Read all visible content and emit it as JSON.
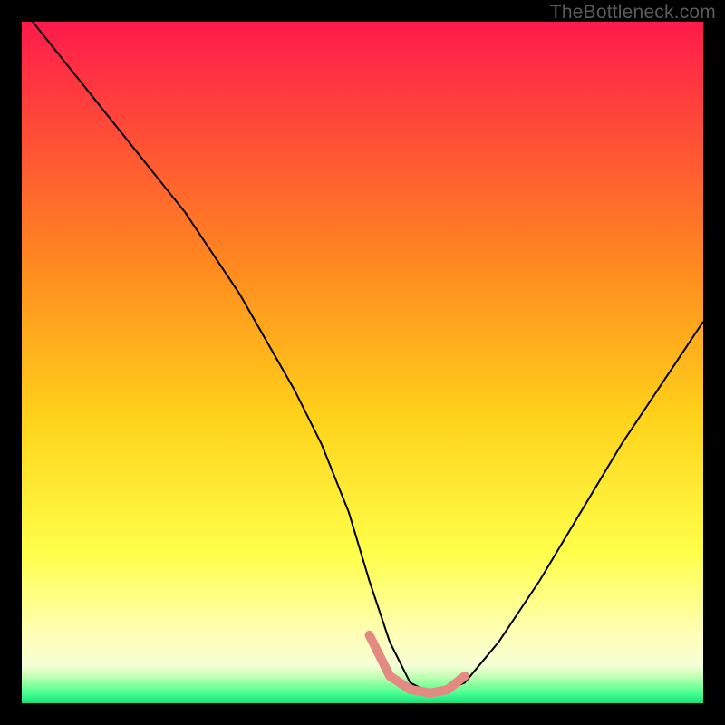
{
  "watermark": "TheBottleneck.com",
  "chart_data": {
    "type": "line",
    "title": "",
    "xlabel": "",
    "ylabel": "",
    "xlim": [
      0,
      100
    ],
    "ylim": [
      0,
      100
    ],
    "grid": false,
    "legend": false,
    "annotations": [],
    "background_gradient_stops": [
      {
        "offset": 0.0,
        "color": "#ff1a4b"
      },
      {
        "offset": 0.36,
        "color": "#ff8a1f"
      },
      {
        "offset": 0.58,
        "color": "#ffd21a"
      },
      {
        "offset": 0.78,
        "color": "#ffff4a"
      },
      {
        "offset": 0.9,
        "color": "#ffffb8"
      },
      {
        "offset": 0.945,
        "color": "#f5ffd6"
      },
      {
        "offset": 0.958,
        "color": "#cdffba"
      },
      {
        "offset": 0.972,
        "color": "#8cff9e"
      },
      {
        "offset": 0.985,
        "color": "#49ff93"
      },
      {
        "offset": 1.0,
        "color": "#18e07a"
      }
    ],
    "series": [
      {
        "name": "bottleneck-curve",
        "color": "#000000",
        "stroke_width": 2,
        "x": [
          0,
          8,
          16,
          24,
          32,
          40,
          44,
          48,
          51,
          54,
          57,
          60,
          62.5,
          65,
          70,
          76,
          82,
          88,
          94,
          100
        ],
        "values": [
          102,
          92,
          82,
          72,
          60,
          46,
          38,
          28,
          18,
          9,
          3,
          1.5,
          2,
          3,
          9,
          18,
          28,
          38,
          47,
          56
        ]
      },
      {
        "name": "optimal-band",
        "color": "#e58a82",
        "stroke_width": 10,
        "linecap": "round",
        "x": [
          51,
          54,
          57,
          60,
          62.5,
          65
        ],
        "values": [
          10,
          4,
          2,
          1.5,
          2,
          4
        ]
      }
    ]
  }
}
